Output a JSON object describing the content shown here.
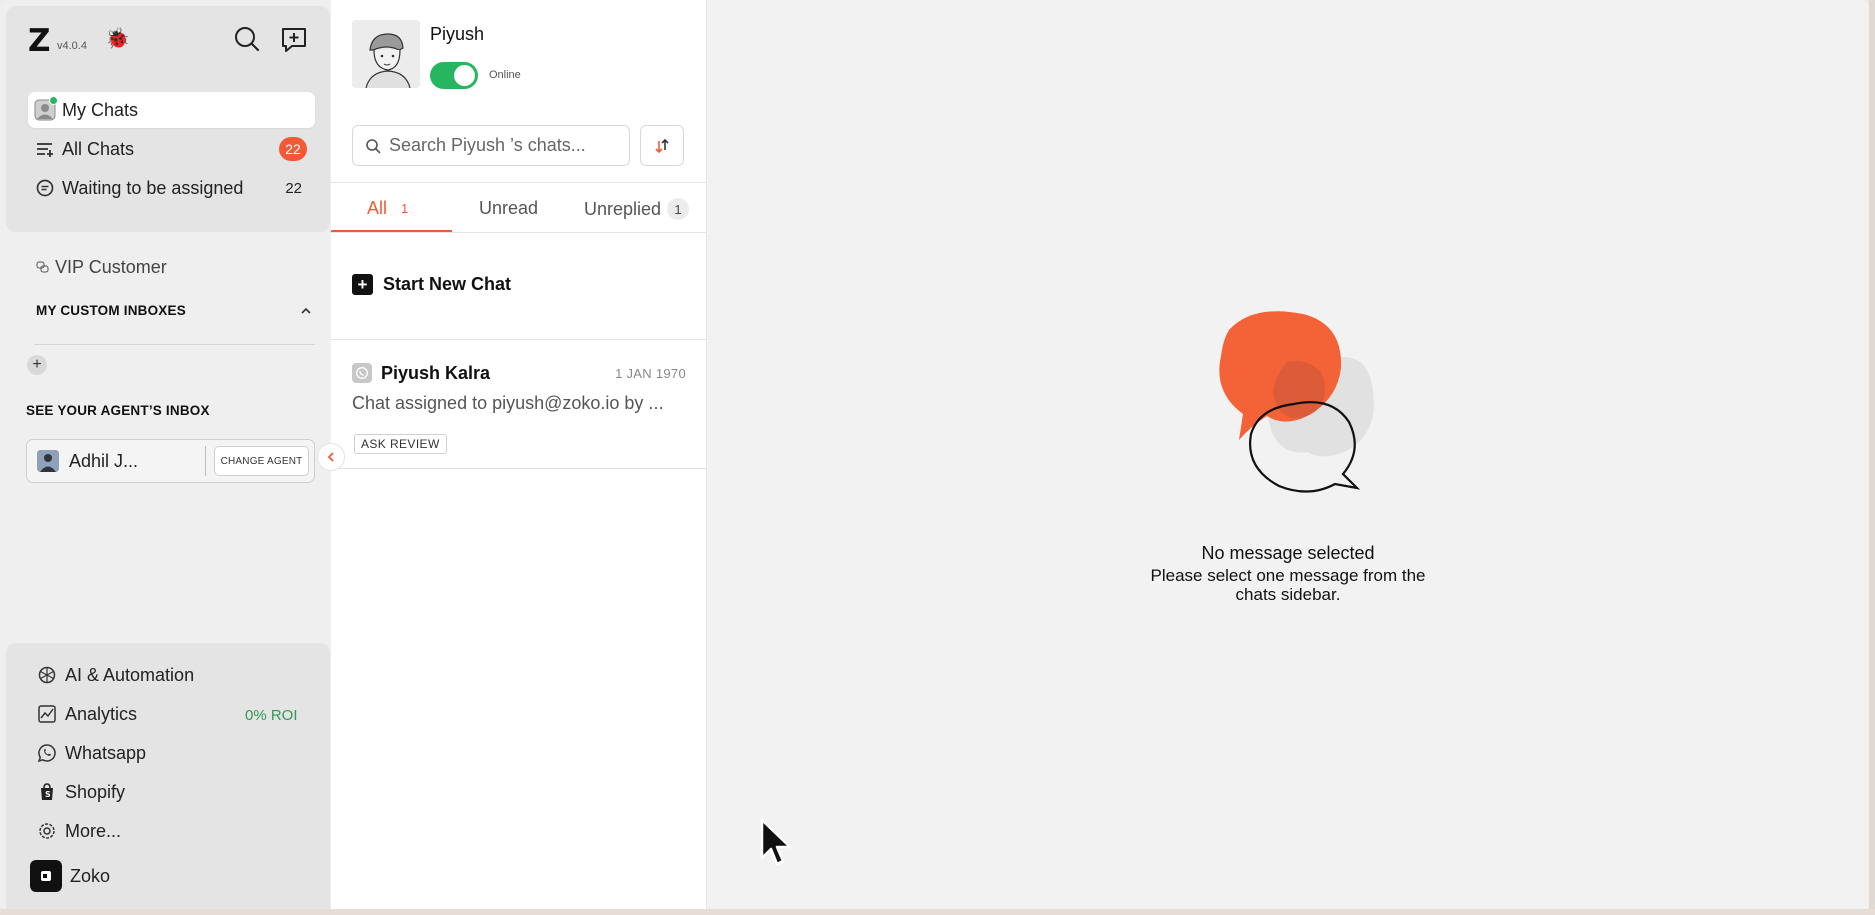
{
  "sidebar": {
    "version": "v4.0.4",
    "nav": {
      "my_chats": "My Chats",
      "all_chats": "All Chats",
      "all_chats_count": "22",
      "waiting": "Waiting to be assigned",
      "waiting_count": "22"
    },
    "vip": "VIP Customer",
    "custom_inboxes_heading": "MY CUSTOM INBOXES",
    "agent_inbox_heading": "SEE YOUR AGENT’S INBOX",
    "agent": {
      "name": "Adhil J...",
      "change_label": "CHANGE AGENT"
    },
    "bottom": {
      "ai": "AI & Automation",
      "analytics": "Analytics",
      "roi": "0% ROI",
      "whatsapp": "Whatsapp",
      "shopify": "Shopify",
      "more": "More...",
      "zoko": "Zoko"
    }
  },
  "chatlist": {
    "profile_name": "Piyush",
    "status": "Online",
    "search_placeholder": "Search Piyush ’s chats...",
    "tabs": [
      {
        "label": "All",
        "count": "1"
      },
      {
        "label": "Unread",
        "count": ""
      },
      {
        "label": "Unreplied",
        "count": "1"
      }
    ],
    "start_new_chat": "Start New Chat",
    "items": [
      {
        "name": "Piyush Kalra",
        "date": "1 JAN 1970",
        "message": "Chat assigned to piyush@zoko.io by ...",
        "tag": "ASK REVIEW"
      }
    ]
  },
  "main": {
    "empty_title": "No message selected",
    "empty_line1": "Please select one message from the",
    "empty_line2": "chats sidebar."
  },
  "colors": {
    "accent": "#f15a35",
    "online_green": "#27b560",
    "roi_green": "#2e9a56"
  }
}
